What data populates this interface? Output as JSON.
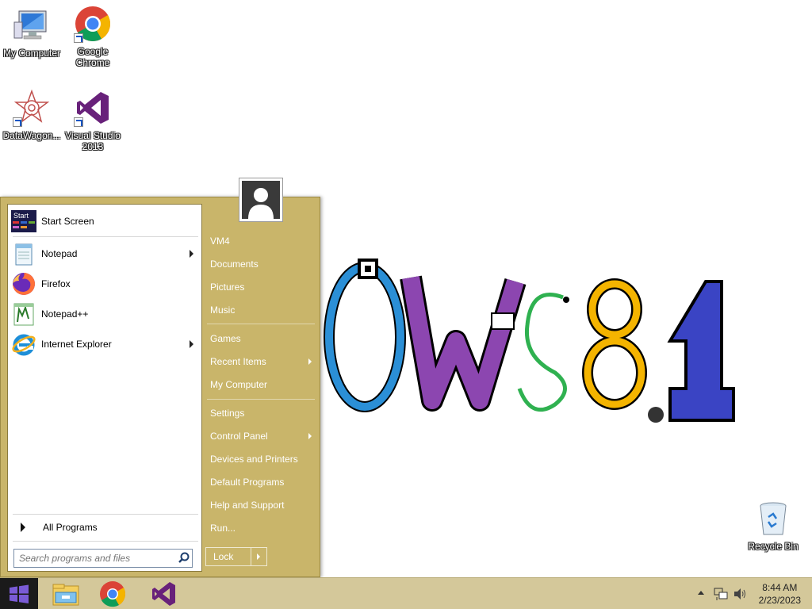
{
  "desktop": {
    "icons": [
      {
        "label": "My Computer"
      },
      {
        "label": "Google Chrome"
      },
      {
        "label": "DataWagon..."
      },
      {
        "label": "Visual Studio 2013"
      },
      {
        "label": "Recycle Bin"
      }
    ]
  },
  "start_menu": {
    "programs": [
      {
        "label": "Start Screen",
        "icon": "start-screen-icon",
        "has_submenu": false
      },
      {
        "label": "Notepad",
        "icon": "notepad-icon",
        "has_submenu": true
      },
      {
        "label": "Firefox",
        "icon": "firefox-icon",
        "has_submenu": false
      },
      {
        "label": "Notepad++",
        "icon": "notepadpp-icon",
        "has_submenu": false
      },
      {
        "label": "Internet Explorer",
        "icon": "internet-explorer-icon",
        "has_submenu": true
      }
    ],
    "start_screen_tile_text": "Start",
    "all_programs": "All Programs",
    "search": {
      "placeholder": "Search programs and files",
      "value": ""
    },
    "right_links": [
      {
        "label": "VM4",
        "has_submenu": false
      },
      {
        "label": "Documents",
        "has_submenu": false
      },
      {
        "label": "Pictures",
        "has_submenu": false
      },
      {
        "label": "Music",
        "has_submenu": false
      },
      {
        "label": "Games",
        "has_submenu": false
      },
      {
        "label": "Recent Items",
        "has_submenu": true
      },
      {
        "label": "My Computer",
        "has_submenu": false
      },
      {
        "label": "Settings",
        "has_submenu": false
      },
      {
        "label": "Control Panel",
        "has_submenu": true
      },
      {
        "label": "Devices and Printers",
        "has_submenu": false
      },
      {
        "label": "Default Programs",
        "has_submenu": false
      },
      {
        "label": "Help and Support",
        "has_submenu": false
      },
      {
        "label": "Run...",
        "has_submenu": false
      }
    ],
    "lock_label": "Lock"
  },
  "taskbar": {
    "pinned": [
      "file-explorer-icon",
      "chrome-icon",
      "visual-studio-icon"
    ],
    "clock": {
      "time": "8:44 AM",
      "date": "2/23/2023"
    }
  },
  "colors": {
    "start_menu_bg": "#c9b56a",
    "taskbar_bg": "#d4c89a"
  }
}
